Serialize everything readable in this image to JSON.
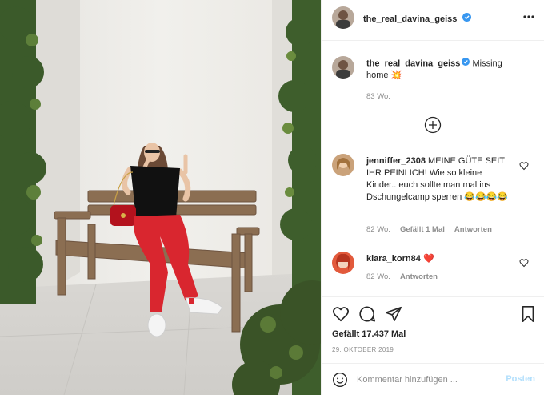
{
  "post": {
    "author": "the_real_davina_geiss",
    "verified": true,
    "more_icon": "more-horizontal-icon"
  },
  "caption": {
    "username": "the_real_davina_geiss",
    "text": " Missing home 💥",
    "age": "83 Wo."
  },
  "load_more_icon": "circle-plus-icon",
  "comments": [
    {
      "username": "jenniffer_2308",
      "text": " MEINE GÜTE SEIT IHR PEINLICH! Wie so kleine Kinder.. euch sollte man mal ins Dschungelcamp sperren 😂😂😂😂",
      "age": "82 Wo.",
      "likes": "Gefällt 1 Mal",
      "reply": "Antworten"
    },
    {
      "username": "klara_korn84",
      "text": " ❤️",
      "age": "82 Wo.",
      "reply": "Antworten"
    }
  ],
  "actions": {
    "likes_text": "Gefällt 17.437 Mal",
    "date": "29. OKTOBER 2019",
    "icons": [
      "heart-icon",
      "comment-icon",
      "share-icon",
      "bookmark-icon"
    ]
  },
  "comment_box": {
    "placeholder": "Kommentar hinzufügen ...",
    "post_label": "Posten"
  },
  "colors": {
    "verified": "#3897f0",
    "post_button_disabled": "#b2dffc",
    "meta_text": "#8e8e8e",
    "jeans": "#d9262f"
  }
}
